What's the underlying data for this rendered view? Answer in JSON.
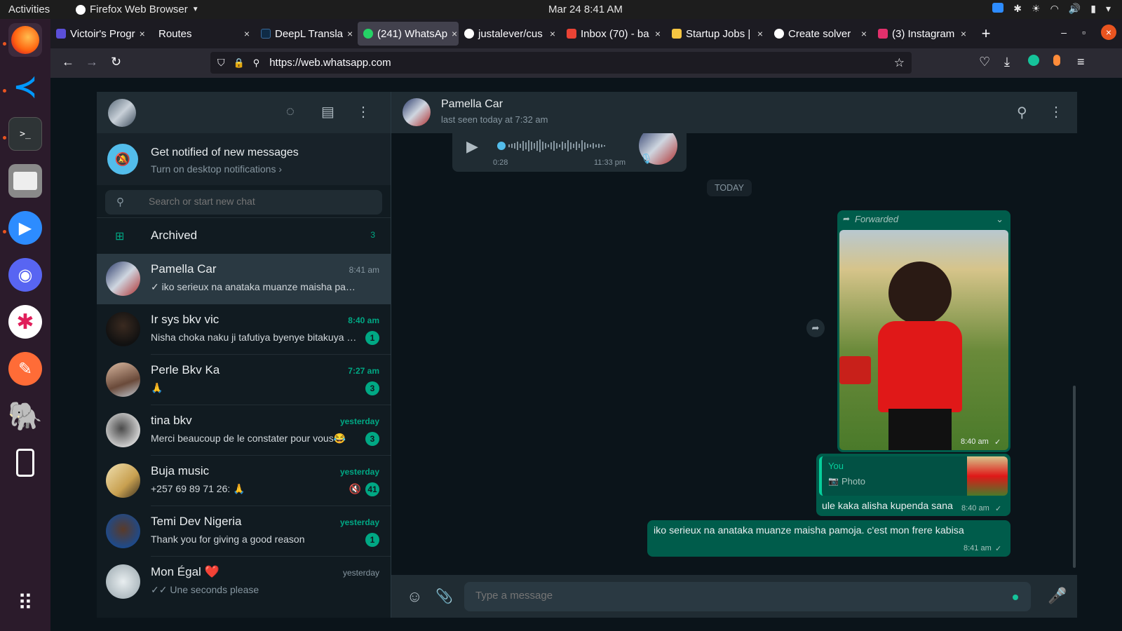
{
  "system": {
    "activities": "Activities",
    "app_name": "Firefox Web Browser",
    "clock": "Mar 24  8:41 AM"
  },
  "browser": {
    "tabs": [
      {
        "label": "Victoir's Progr",
        "icon_color": "#5b4fd8"
      },
      {
        "label": "Routes",
        "icon_color": ""
      },
      {
        "label": "DeepL Transla",
        "icon_color": "#0f2b46"
      },
      {
        "label": "(241) WhatsAp",
        "icon_color": "#25d366"
      },
      {
        "label": "justalever/cus",
        "icon_color": "#ffffff"
      },
      {
        "label": "Inbox (70) - ba",
        "icon_color": "#ea4335"
      },
      {
        "label": "Startup Jobs |",
        "icon_color": "#f5c542"
      },
      {
        "label": "Create solver",
        "icon_color": "#ffffff"
      },
      {
        "label": "(3) Instagram",
        "icon_color": "#e1306c"
      }
    ],
    "url": "https://web.whatsapp.com"
  },
  "whatsapp": {
    "notification": {
      "title": "Get notified of new messages",
      "subtitle": "Turn on desktop notifications ›"
    },
    "search_placeholder": "Search or start new chat",
    "archived": {
      "label": "Archived",
      "count": "3"
    },
    "chats": [
      {
        "name": "Pamella Car",
        "preview": "✓ iko serieux na anataka muanze maisha pamoja. c'est mon frere kabisa",
        "time": "8:41 am",
        "badge": "",
        "unread": false
      },
      {
        "name": "Ir sys bkv vic",
        "preview": "Nisha choka naku ji tafutiya byenye bitakuya Mungu aki penda",
        "time": "8:40 am",
        "badge": "1",
        "unread": true
      },
      {
        "name": "Perle Bkv Ka",
        "preview": "🙏",
        "time": "7:27 am",
        "badge": "3",
        "unread": true
      },
      {
        "name": "tina bkv",
        "preview": "Merci beaucoup de le constater pour vous😂",
        "time": "yesterday",
        "badge": "3",
        "unread": true
      },
      {
        "name": "Buja music",
        "preview": "+257 69 89 71 26: 🙏",
        "time": "yesterday",
        "badge": "41",
        "unread": true
      },
      {
        "name": "Temi Dev Nigeria",
        "preview": "Thank you for giving a good reason",
        "time": "yesterday",
        "badge": "1",
        "unread": true
      },
      {
        "name": "Mon Égal ❤️",
        "preview": "✓✓ Une seconds please",
        "time": "yesterday",
        "badge": "",
        "unread": false
      }
    ],
    "conversation": {
      "contact_name": "Pamella Car",
      "last_seen": "last seen today at 7:32 am",
      "voice_note": {
        "duration": "0:28",
        "time": "11:33 pm"
      },
      "date_divider": "TODAY",
      "forwarded_label": "Forwarded",
      "photo_time": "8:40 am",
      "reply": {
        "author": "You",
        "type": "Photo",
        "text": "ule kaka alisha kupenda sana",
        "time": "8:40 am"
      },
      "last_message": {
        "text": "iko serieux na anataka muanze maisha pamoja. c'est mon frere kabisa",
        "time": "8:41 am"
      }
    },
    "compose_placeholder": "Type a message"
  }
}
